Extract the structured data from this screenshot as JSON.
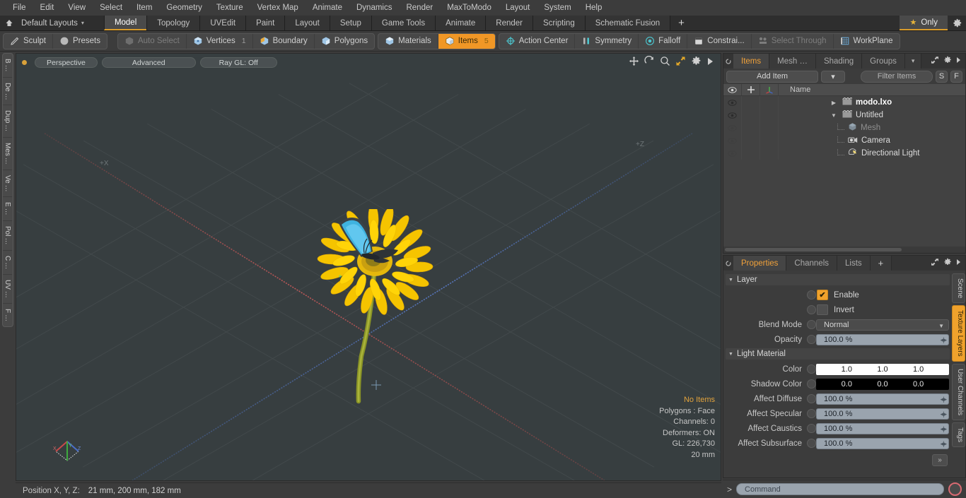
{
  "menubar": {
    "items": [
      "File",
      "Edit",
      "View",
      "Select",
      "Item",
      "Geometry",
      "Texture",
      "Vertex Map",
      "Animate",
      "Dynamics",
      "Render",
      "MaxToModo",
      "Layout",
      "System",
      "Help"
    ]
  },
  "layoutbar": {
    "layouts_label": "Default Layouts",
    "caret": "▾",
    "tabs": [
      {
        "label": "Model",
        "active": true
      },
      {
        "label": "Topology",
        "active": false
      },
      {
        "label": "UVEdit",
        "active": false
      },
      {
        "label": "Paint",
        "active": false
      },
      {
        "label": "Layout",
        "active": false
      },
      {
        "label": "Setup",
        "active": false
      },
      {
        "label": "Game Tools",
        "active": false
      },
      {
        "label": "Animate",
        "active": false
      },
      {
        "label": "Render",
        "active": false
      },
      {
        "label": "Scripting",
        "active": false
      },
      {
        "label": "Schematic Fusion",
        "active": false
      }
    ],
    "add_tab": "+",
    "only_label": "Only",
    "only_star": "★"
  },
  "toolbar": {
    "group1": [
      {
        "label": "Sculpt",
        "icon": "pen-icon",
        "state": "normal",
        "count": ""
      },
      {
        "label": "Presets",
        "icon": "sphere-icon",
        "state": "normal",
        "count": ""
      }
    ],
    "group2": [
      {
        "label": "Auto Select",
        "icon": "cube-gray-icon",
        "state": "dim",
        "count": ""
      },
      {
        "label": "Vertices",
        "icon": "cube-vertex-icon",
        "state": "normal",
        "count": "1"
      },
      {
        "label": "Boundary",
        "icon": "cube-boundary-icon",
        "state": "normal",
        "count": ""
      },
      {
        "label": "Polygons",
        "icon": "cube-polygon-icon",
        "state": "normal",
        "count": ""
      }
    ],
    "group3": [
      {
        "label": "Materials",
        "icon": "cube-material-icon",
        "state": "normal",
        "count": ""
      },
      {
        "label": "Items",
        "icon": "cube-items-icon",
        "state": "active",
        "count": "5"
      }
    ],
    "group4": [
      {
        "label": "Action Center",
        "icon": "action-center-icon",
        "state": "normal",
        "count": ""
      },
      {
        "label": "Symmetry",
        "icon": "symmetry-icon",
        "state": "normal",
        "count": ""
      },
      {
        "label": "Falloff",
        "icon": "falloff-icon",
        "state": "normal",
        "count": ""
      },
      {
        "label": "Constrai...",
        "icon": "constraint-icon",
        "state": "normal",
        "count": ""
      },
      {
        "label": "Select Through",
        "icon": "select-through-icon",
        "state": "dim",
        "count": ""
      },
      {
        "label": "WorkPlane",
        "icon": "workplane-icon",
        "state": "normal",
        "count": ""
      }
    ]
  },
  "left_tabs": [
    "B …",
    "De …",
    "Dup …",
    "Mes …",
    "Ve …",
    "E …",
    "Pol …",
    "C …",
    "UV …",
    "F …"
  ],
  "viewport": {
    "pills": [
      "Perspective",
      "Advanced",
      "Ray GL: Off"
    ],
    "tools": [
      "move-icon",
      "rotate-icon",
      "zoom-icon",
      "fit-icon",
      "gear-icon",
      "play-icon"
    ],
    "axis_labels": {
      "x": "+X",
      "z": "+Z"
    },
    "info": {
      "selection": "No Items",
      "polygons": "Polygons : Face",
      "channels": "Channels: 0",
      "deformers": "Deformers: ON",
      "gl": "GL: 226,730",
      "scale": "20 mm"
    },
    "scene_description": "yellow gerbera daisy with blue butterfly"
  },
  "statusbar": {
    "label": "Position X, Y, Z:",
    "value": "21 mm, 200 mm, 182 mm"
  },
  "items_panel": {
    "tabs": [
      {
        "label": "Items",
        "active": true
      },
      {
        "label": "Mesh …",
        "active": false
      },
      {
        "label": "Shading",
        "active": false
      },
      {
        "label": "Groups",
        "active": false
      }
    ],
    "tab_caret": "▾",
    "add_item": "Add Item",
    "add_item_caret": "▾",
    "filter_placeholder": "Filter Items",
    "btn_s": "S",
    "btn_f": "F",
    "column_name": "Name",
    "rows": [
      {
        "label": "modo.lxo",
        "icon": "scene-icon",
        "indent": 0,
        "twist": "▶",
        "eye": true,
        "bold": true,
        "dim": false
      },
      {
        "label": "Untitled",
        "icon": "scene-icon",
        "indent": 0,
        "twist": "▼",
        "eye": true,
        "bold": false,
        "dim": false
      },
      {
        "label": "Mesh",
        "icon": "mesh-icon",
        "indent": 1,
        "twist": "",
        "eye": true,
        "bold": false,
        "dim": true
      },
      {
        "label": "Camera",
        "icon": "camera-icon",
        "indent": 1,
        "twist": "",
        "eye": true,
        "bold": false,
        "dim": false
      },
      {
        "label": "Directional Light",
        "icon": "light-icon",
        "indent": 1,
        "twist": "",
        "eye": true,
        "bold": false,
        "dim": false
      }
    ]
  },
  "properties_panel": {
    "tabs": [
      {
        "label": "Properties",
        "active": true
      },
      {
        "label": "Channels",
        "active": false
      },
      {
        "label": "Lists",
        "active": false
      }
    ],
    "add_tab": "+",
    "sections": {
      "layer": "Layer",
      "light_material": "Light Material"
    },
    "layer": {
      "enable_label": "Enable",
      "enable_checked": true,
      "invert_label": "Invert",
      "invert_checked": false,
      "blend_mode_label": "Blend Mode",
      "blend_mode_value": "Normal",
      "opacity_label": "Opacity",
      "opacity_value": "100.0 %"
    },
    "light_material": {
      "color_label": "Color",
      "color_values": [
        "1.0",
        "1.0",
        "1.0"
      ],
      "shadow_color_label": "Shadow Color",
      "shadow_color_values": [
        "0.0",
        "0.0",
        "0.0"
      ],
      "affect_diffuse_label": "Affect Diffuse",
      "affect_diffuse_value": "100.0 %",
      "affect_specular_label": "Affect Specular",
      "affect_specular_value": "100.0 %",
      "affect_caustics_label": "Affect Caustics",
      "affect_caustics_value": "100.0 %",
      "affect_subsurface_label": "Affect Subsurface",
      "affect_subsurface_value": "100.0 %"
    },
    "expand_button": "»",
    "side_tabs": [
      {
        "label": "Scene",
        "active": false
      },
      {
        "label": "Texture Layers",
        "active": true
      },
      {
        "label": "User Channels",
        "active": false
      },
      {
        "label": "Tags",
        "active": false
      }
    ]
  },
  "command_bar": {
    "prompt": ">",
    "placeholder": "Command",
    "record_icon": "record-icon"
  },
  "colors": {
    "accent_orange": "#f0a22c",
    "tab_underline": "#d99b2b",
    "panel_bg": "#3c3c3c",
    "viewport_bg": "#373e40",
    "field_blue_gray": "#9aa4ae",
    "axis_x": "#b04a4a",
    "axis_z": "#4a6bb0",
    "record_red": "#d96a72"
  }
}
